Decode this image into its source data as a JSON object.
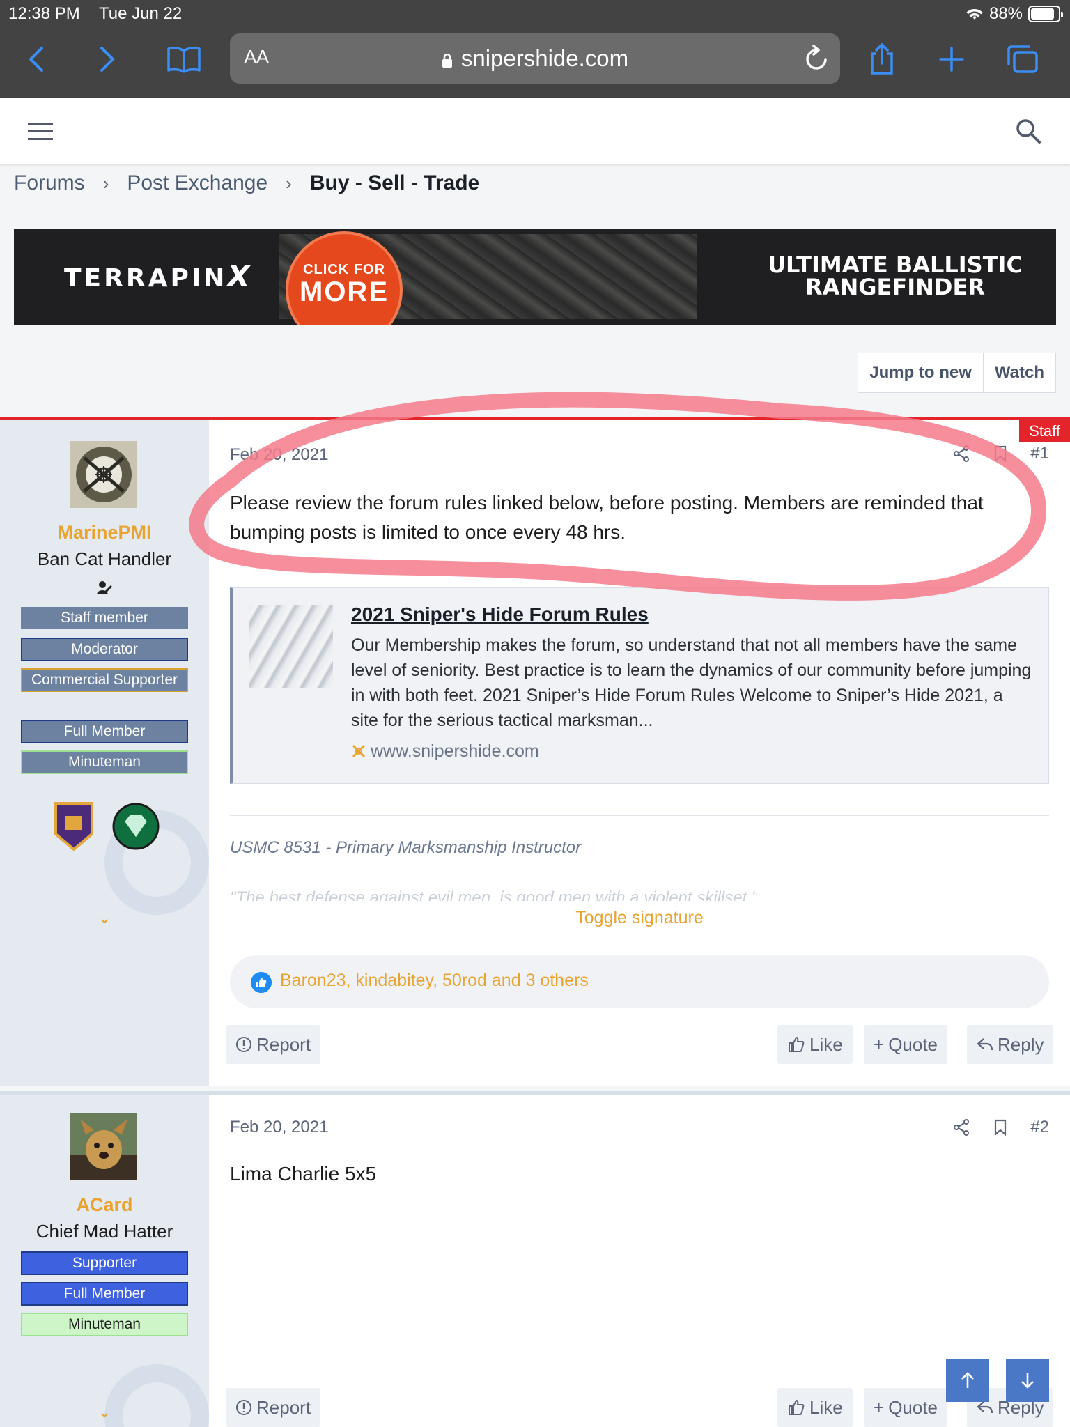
{
  "status_bar": {
    "time": "12:38 PM",
    "date": "Tue Jun 22",
    "battery": "88%"
  },
  "browser": {
    "text_size_label": "AA",
    "url": "snipershide.com"
  },
  "breadcrumb": {
    "items": [
      "Forums",
      "Post Exchange"
    ],
    "current": "Buy - Sell - Trade"
  },
  "ad_banner": {
    "logo": "TERRAPIN",
    "logo_mark": "X",
    "cta_small": "CLICK FOR",
    "cta_big": "MORE",
    "tagline_1": "ULTIMATE BALLISTIC",
    "tagline_2": "RANGEFINDER"
  },
  "thread_tools": {
    "jump_label": "Jump to new",
    "watch_label": "Watch"
  },
  "post1": {
    "username": "MarinePMI",
    "user_title": "Ban Cat Handler",
    "banners": [
      "Staff member",
      "Moderator",
      "Commercial Supporter",
      "Full Member",
      "Minuteman"
    ],
    "staff_tag": "Staff",
    "date": "Feb 20, 2021",
    "number": "#1",
    "body": "Please review the forum rules linked below, before posting. Members are reminded that bumping posts is limited to once every 48 hrs.",
    "unfurl": {
      "title": "2021 Sniper's Hide Forum Rules",
      "description": "Our Membership makes the forum, so understand that not all members have the same level of seniority. Best practice is to learn the dynamics of our community before jumping in with both feet. 2021 Sniper’s Hide Forum Rules Welcome to Sniper’s Hide 2021, a site for the serious tactical marksman...",
      "domain": "www.snipershide.com"
    },
    "signature_line": "USMC 8531 - Primary Marksmanship Instructor",
    "signature_quote": "\"The best defense against evil men, is good men with a violent skillset.\"",
    "toggle_signature": "Toggle signature",
    "reactions": "Baron23, kindabitey, 50rod and 3 others",
    "report": "Report",
    "like": "Like",
    "quote": "Quote",
    "reply": "Reply"
  },
  "post2": {
    "username": "ACard",
    "user_title": "Chief Mad Hatter",
    "banners": [
      "Supporter",
      "Full Member",
      "Minuteman"
    ],
    "date": "Feb 20, 2021",
    "number": "#2",
    "body": "Lima Charlie 5x5",
    "report": "Report",
    "like": "Like",
    "quote": "Quote",
    "reply": "Reply"
  },
  "colors": {
    "accent": "#e8a331",
    "staff_red": "#e3242b",
    "link_blue": "#3a8ef6",
    "highlight": "#f47a8a"
  }
}
